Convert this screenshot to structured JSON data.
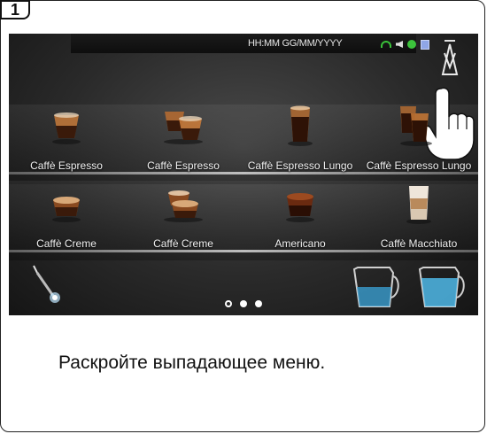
{
  "step": {
    "number": "1"
  },
  "status_bar": {
    "time_date": "HH:MM GG/MM/YYYY"
  },
  "beverages": [
    {
      "label": "Caffè Espresso",
      "cup": "espresso-cup-icon"
    },
    {
      "label": "Caffè Espresso",
      "cup": "double-espresso-cups-icon"
    },
    {
      "label": "Caffè Espresso Lungo",
      "cup": "lungo-glass-icon"
    },
    {
      "label": "Caffè Espresso Lungo",
      "cup": "double-lungo-glasses-icon"
    },
    {
      "label": "Caffè Creme",
      "cup": "creme-cup-icon"
    },
    {
      "label": "Caffè Creme",
      "cup": "double-creme-cups-icon"
    },
    {
      "label": "Americano",
      "cup": "americano-cup-icon"
    },
    {
      "label": "Caffè Macchiato",
      "cup": "macchiato-glass-icon"
    }
  ],
  "pager": {
    "pages": 3,
    "current_page": 1
  },
  "icons": {
    "dropdown": "chevron-down-icon",
    "hand": "pointing-hand-icon",
    "steam_wand": "steam-wand-icon",
    "milk_jugs": "milk-jug-icon"
  },
  "colors": {
    "status_green": "#39c239",
    "water_blue": "#3a9ed0"
  },
  "instruction_text": "Раскройте выпадающее меню."
}
